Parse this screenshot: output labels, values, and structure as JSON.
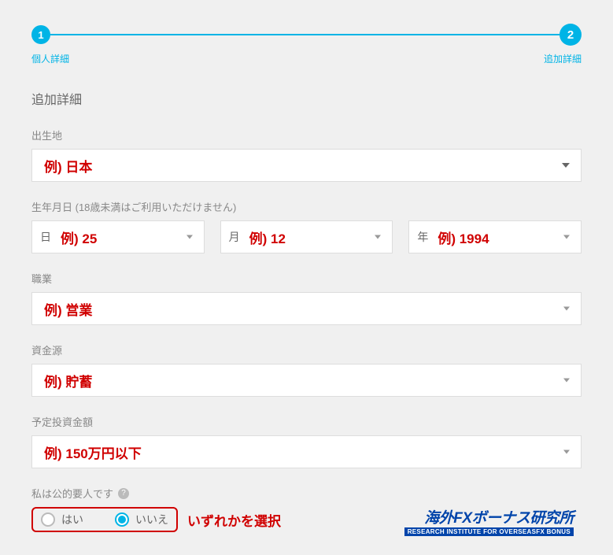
{
  "progress": {
    "step1": {
      "number": "1",
      "label": "個人詳細"
    },
    "step2": {
      "number": "2",
      "label": "追加詳細"
    }
  },
  "section_title": "追加詳細",
  "birthplace": {
    "label": "出生地",
    "example": "例) 日本"
  },
  "dob": {
    "label": "生年月日 (18歳未満はご利用いただけません)",
    "day": {
      "prefix": "日",
      "example": "例) 25"
    },
    "month": {
      "prefix": "月",
      "example": "例) 12"
    },
    "year": {
      "prefix": "年",
      "example": "例) 1994"
    }
  },
  "occupation": {
    "label": "職業",
    "example": "例) 営業"
  },
  "funding_source": {
    "label": "資金源",
    "example": "例) 貯蓄"
  },
  "investment_amount": {
    "label": "予定投資金額",
    "example": "例) 150万円以下"
  },
  "pep": {
    "label": "私は公的要人です",
    "yes": "はい",
    "no": "いいえ",
    "annotation": "いずれかを選択"
  },
  "watermark": {
    "main": "海外FXボーナス研究所",
    "sub": "RESEARCH INSTITUTE FOR OVERSEASFX BONUS"
  }
}
